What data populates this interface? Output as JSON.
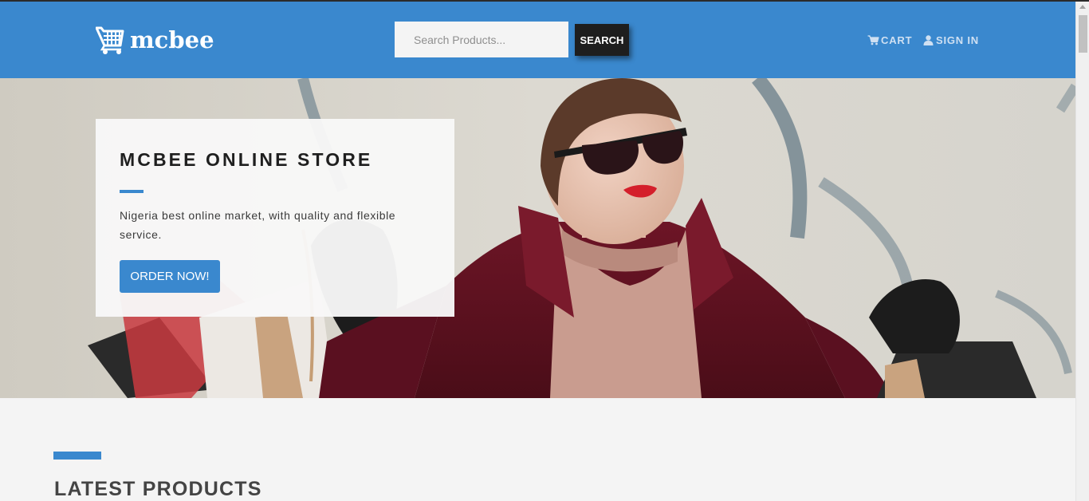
{
  "brand": {
    "name": "mcbee",
    "logo_icon": "shopping-cart-icon",
    "primary_color": "#3a88ce",
    "dark_color": "#1e1e1e"
  },
  "header": {
    "search_placeholder": "Search Products...",
    "search_label": "SEARCH",
    "nav": {
      "cart": {
        "label": "CART",
        "icon": "cart-icon"
      },
      "signin": {
        "label": "SIGN IN",
        "icon": "user-icon"
      }
    }
  },
  "hero": {
    "title": "MCBEE ONLINE STORE",
    "description": "Nigeria best online market, with quality and flexible service.",
    "cta_label": "ORDER NOW!"
  },
  "section": {
    "title": "LATEST PRODUCTS"
  }
}
